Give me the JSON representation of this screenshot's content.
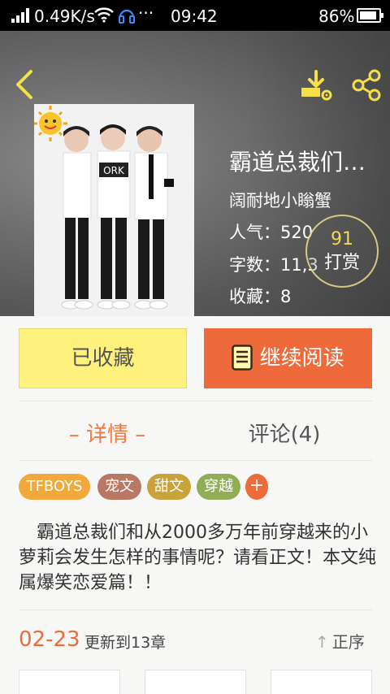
{
  "status_bar": {
    "speed": "0.49K/s",
    "dots": "···",
    "time": "09:42",
    "battery": "86%"
  },
  "book": {
    "title": "霸道总裁们…",
    "author": "阔耐地小瞈蟹",
    "popularity": "人气：520",
    "word_count": "字数：11,3",
    "favorites": "收藏：8",
    "cover_text": "ORK"
  },
  "reward": {
    "count": "91",
    "label": "打赏"
  },
  "actions": {
    "collect": "已收藏",
    "continue_reading": "继续阅读"
  },
  "tabs": {
    "detail": "– 详情 –",
    "comments": "评论(4)"
  },
  "tags": [
    {
      "label": "TFBOYS",
      "color": "#f0a93a"
    },
    {
      "label": "宠文",
      "color": "#b97865"
    },
    {
      "label": "甜文",
      "color": "#c9a23c"
    },
    {
      "label": "穿越",
      "color": "#8fae55"
    }
  ],
  "add_tag": "+",
  "description": "霸道总裁们和从2000多万年前穿越来的小萝莉会发生怎样的事情呢？请看正文！本文纯属爆笑恋爱篇！！",
  "chapters": {
    "date": "02-23",
    "update": "更新到13章",
    "sort": "正序"
  },
  "colors": {
    "accent": "#ef6a3a",
    "collect_bg": "#fff17e",
    "icon_yellow": "#f5e04a"
  }
}
